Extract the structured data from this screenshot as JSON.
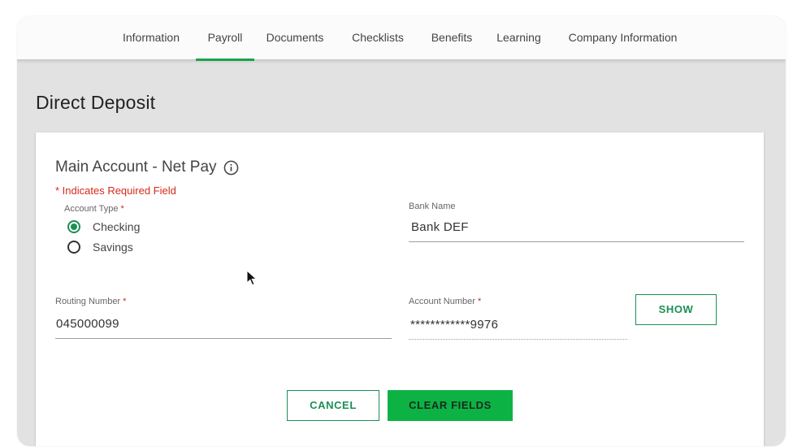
{
  "nav": {
    "tabs": [
      {
        "label": "Information"
      },
      {
        "label": "Payroll",
        "active": true
      },
      {
        "label": "Documents"
      },
      {
        "label": "Checklists"
      },
      {
        "label": "Benefits"
      },
      {
        "label": "Learning"
      },
      {
        "label": "Company Information"
      }
    ]
  },
  "page": {
    "title": "Direct Deposit"
  },
  "section": {
    "title": "Main Account - Net Pay",
    "required_note": "* Indicates Required Field"
  },
  "account_type": {
    "label": "Account Type",
    "required_marker": "*",
    "options": [
      {
        "label": "Checking",
        "selected": true
      },
      {
        "label": "Savings",
        "selected": false
      }
    ]
  },
  "bank_name": {
    "label": "Bank Name",
    "value": "Bank DEF"
  },
  "routing_number": {
    "label": "Routing Number",
    "required_marker": "*",
    "value": "045000099"
  },
  "account_number": {
    "label": "Account Number",
    "required_marker": "*",
    "value": "************9976"
  },
  "buttons": {
    "show": "SHOW",
    "cancel": "CANCEL",
    "clear": "CLEAR FIELDS"
  },
  "colors": {
    "accent": "#1aa34a",
    "required": "#d42a1e",
    "primary_button": "#0cb344"
  }
}
